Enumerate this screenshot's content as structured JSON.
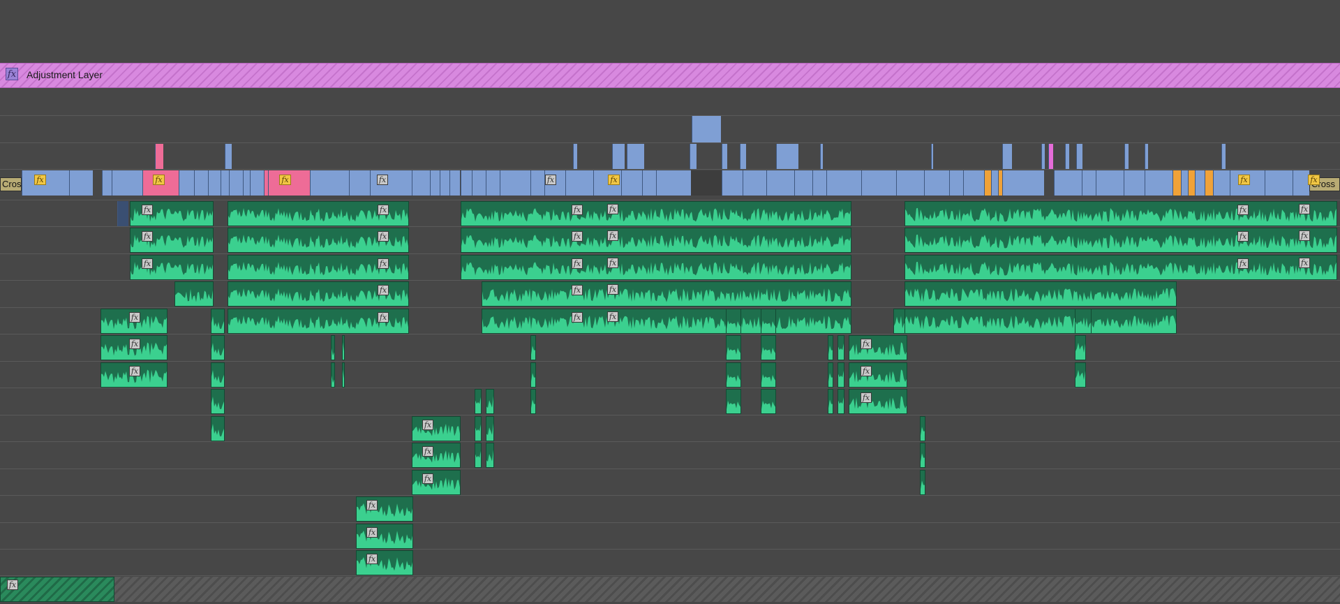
{
  "adjustment_layer": {
    "label": "Adjustment Layer",
    "badge": "fx"
  },
  "transitions": {
    "left_label": "Cros",
    "right_label": "Cross"
  },
  "fx_label": "fx",
  "video_clip_colors": {
    "default": "#7f9fd4",
    "pink": "#ee6c97",
    "orange": "#f0a238",
    "adjustment": "#d889df"
  },
  "audio_clip_color": "#1e6f4d",
  "waveform_color": "#3bd08f"
}
